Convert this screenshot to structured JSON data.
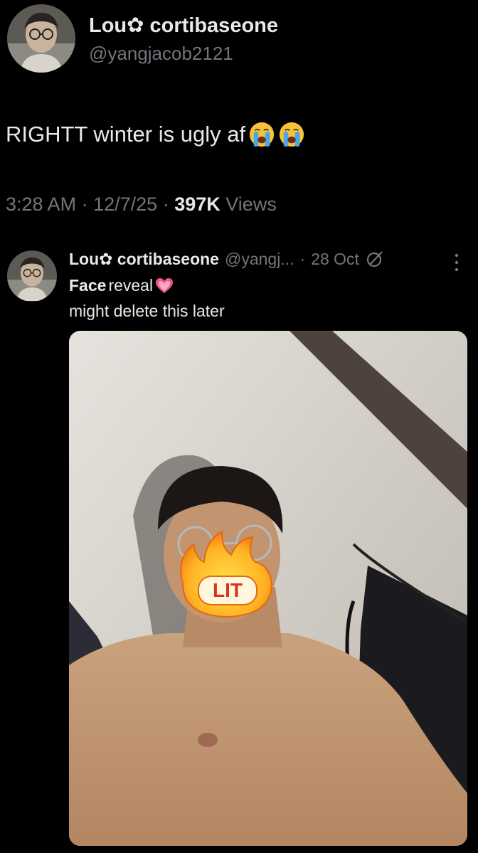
{
  "main_tweet": {
    "display_name": "Lou✿ cortibaseone",
    "handle": "@yangjacob2121",
    "text": "RIGHTT winter is ugly af",
    "time": "3:28 AM",
    "date": "12/7/25",
    "views_count": "397K",
    "views_label": "Views",
    "separator": "·"
  },
  "quoted_tweet": {
    "display_name": "Lou✿ cortibaseone",
    "handle": "@yangj...",
    "date": "28 Oct",
    "separator": "·",
    "line1_bold": "Face",
    "line1_rest": "reveal",
    "line2": "might delete this later",
    "sticker_text": "LIT"
  },
  "icons": {
    "emoji": "loudly-crying-face-icon",
    "heart": "heart-icon",
    "edit": "edit-circle-icon",
    "more": "more-vertical-icon"
  },
  "colors": {
    "background": "#000000",
    "text_primary": "#e7e9ea",
    "text_secondary": "#71767b",
    "heart": "#e8598f"
  }
}
